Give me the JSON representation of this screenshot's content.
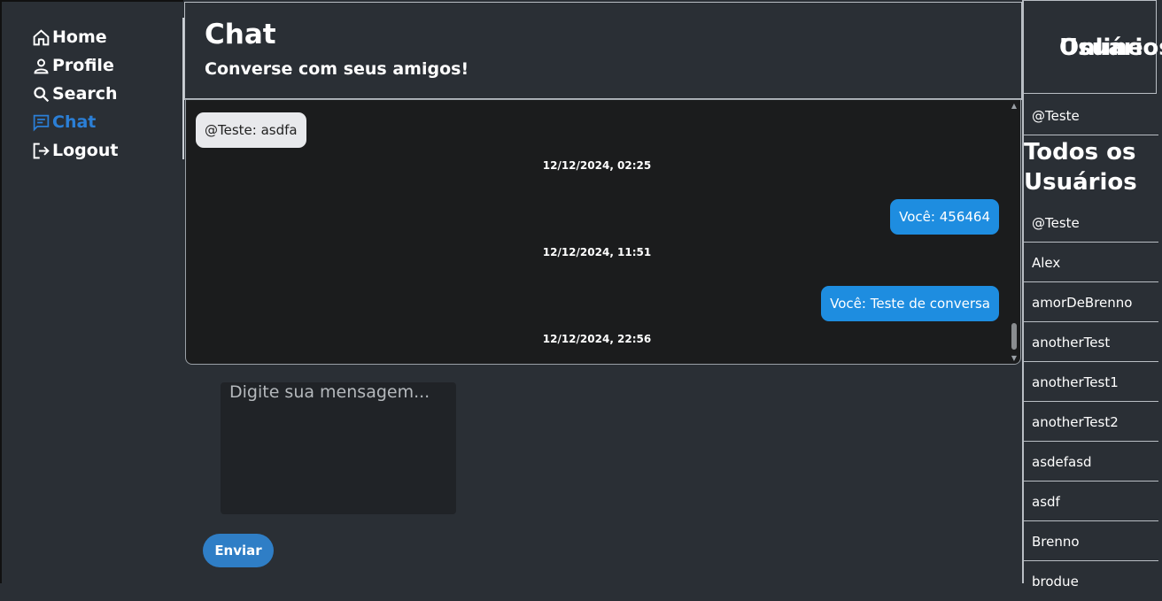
{
  "nav": {
    "items": [
      {
        "label": "Home",
        "icon": "home-icon"
      },
      {
        "label": "Profile",
        "icon": "user-icon"
      },
      {
        "label": "Search",
        "icon": "search-icon"
      },
      {
        "label": "Chat",
        "icon": "chat-icon",
        "active": true
      },
      {
        "label": "Logout",
        "icon": "logout-icon"
      }
    ],
    "active_color": "#2b7fd6"
  },
  "header": {
    "title": "Chat",
    "subtitle": "Converse com seus amigos!"
  },
  "messages": [
    {
      "text": "@Teste: asdfa",
      "time": "12/12/2024, 02:25",
      "side": "received"
    },
    {
      "text": "Você: 456464",
      "time": "12/12/2024, 11:51",
      "side": "sent"
    },
    {
      "text": "Você: Teste de conversa",
      "time": "12/12/2024, 22:56",
      "side": "sent"
    }
  ],
  "composer": {
    "placeholder": "Digite sua mensagem...",
    "send_label": "Enviar"
  },
  "online": {
    "title_line1": "Usuários",
    "title_line2": "Online",
    "users": [
      "@Teste"
    ]
  },
  "all_users": {
    "title_line1": "Todos os",
    "title_line2": "Usuários",
    "users": [
      "@Teste",
      "Alex",
      "amorDeBrenno",
      "anotherTest",
      "anotherTest1",
      "anotherTest2",
      "asdefasd",
      "asdf",
      "Brenno",
      "brodue"
    ]
  },
  "colors": {
    "background": "#2a2f35",
    "chat_background": "#1b1c1d",
    "sent_bubble": "#1e8de0",
    "received_bubble": "#e8e9ec",
    "button": "#2f7ec6"
  }
}
